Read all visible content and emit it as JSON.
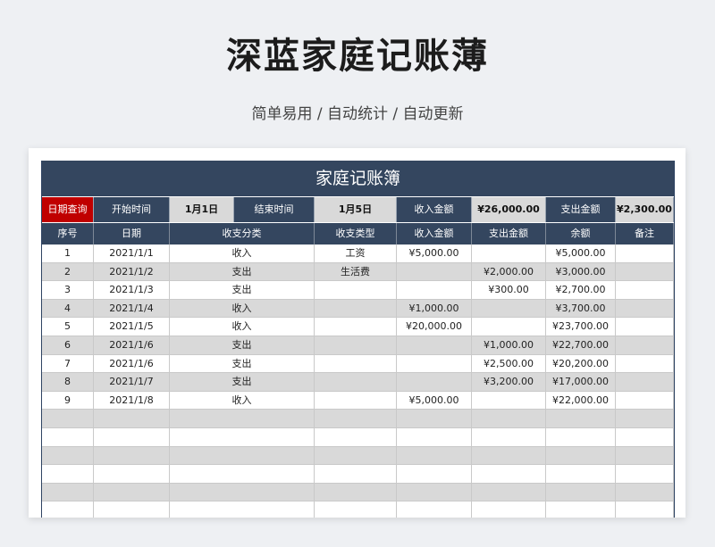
{
  "hero": {
    "title": "深蓝家庭记账薄",
    "subtitle": "简单易用 / 自动统计 / 自动更新"
  },
  "sheet": {
    "title": "家庭记账簿",
    "filter": {
      "query_label": "日期查询",
      "start_label": "开始时间",
      "start_value": "1月1日",
      "end_label": "结束时间",
      "end_value": "1月5日",
      "income_label": "收入金额",
      "income_value": "¥26,000.00",
      "expense_label": "支出金额",
      "expense_value": "¥2,300.00"
    },
    "columns": [
      "序号",
      "日期",
      "收支分类",
      "收支类型",
      "收入金额",
      "支出金额",
      "余额",
      "备注"
    ],
    "rows": [
      {
        "no": "1",
        "date": "2021/1/1",
        "cat": "收入",
        "type": "工资",
        "income": "¥5,000.00",
        "expense": "",
        "balance": "¥5,000.00",
        "note": ""
      },
      {
        "no": "2",
        "date": "2021/1/2",
        "cat": "支出",
        "type": "生活费",
        "income": "",
        "expense": "¥2,000.00",
        "balance": "¥3,000.00",
        "note": ""
      },
      {
        "no": "3",
        "date": "2021/1/3",
        "cat": "支出",
        "type": "",
        "income": "",
        "expense": "¥300.00",
        "balance": "¥2,700.00",
        "note": ""
      },
      {
        "no": "4",
        "date": "2021/1/4",
        "cat": "收入",
        "type": "",
        "income": "¥1,000.00",
        "expense": "",
        "balance": "¥3,700.00",
        "note": ""
      },
      {
        "no": "5",
        "date": "2021/1/5",
        "cat": "收入",
        "type": "",
        "income": "¥20,000.00",
        "expense": "",
        "balance": "¥23,700.00",
        "note": ""
      },
      {
        "no": "6",
        "date": "2021/1/6",
        "cat": "支出",
        "type": "",
        "income": "",
        "expense": "¥1,000.00",
        "balance": "¥22,700.00",
        "note": ""
      },
      {
        "no": "7",
        "date": "2021/1/6",
        "cat": "支出",
        "type": "",
        "income": "",
        "expense": "¥2,500.00",
        "balance": "¥20,200.00",
        "note": ""
      },
      {
        "no": "8",
        "date": "2021/1/7",
        "cat": "支出",
        "type": "",
        "income": "",
        "expense": "¥3,200.00",
        "balance": "¥17,000.00",
        "note": ""
      },
      {
        "no": "9",
        "date": "2021/1/8",
        "cat": "收入",
        "type": "",
        "income": "¥5,000.00",
        "expense": "",
        "balance": "¥22,000.00",
        "note": ""
      },
      {
        "no": "",
        "date": "",
        "cat": "",
        "type": "",
        "income": "",
        "expense": "",
        "balance": "",
        "note": ""
      },
      {
        "no": "",
        "date": "",
        "cat": "",
        "type": "",
        "income": "",
        "expense": "",
        "balance": "",
        "note": ""
      },
      {
        "no": "",
        "date": "",
        "cat": "",
        "type": "",
        "income": "",
        "expense": "",
        "balance": "",
        "note": ""
      },
      {
        "no": "",
        "date": "",
        "cat": "",
        "type": "",
        "income": "",
        "expense": "",
        "balance": "",
        "note": ""
      },
      {
        "no": "",
        "date": "",
        "cat": "",
        "type": "",
        "income": "",
        "expense": "",
        "balance": "",
        "note": ""
      },
      {
        "no": "",
        "date": "",
        "cat": "",
        "type": "",
        "income": "",
        "expense": "",
        "balance": "",
        "note": ""
      }
    ]
  },
  "colors": {
    "header_navy": "#34465f",
    "query_red": "#c00000",
    "stripe_gray": "#d9d9d9"
  }
}
